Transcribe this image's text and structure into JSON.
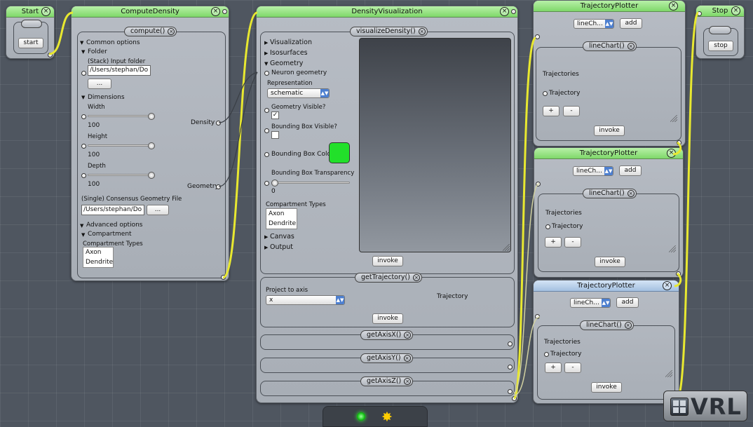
{
  "start_window": {
    "title": "Start",
    "button": "start"
  },
  "stop_window": {
    "title": "Stop",
    "button": "stop"
  },
  "compute_density": {
    "title": "ComputeDensity",
    "method": "compute()",
    "common_options": "Common options",
    "folder": "Folder",
    "input_folder_label": "(Stack) Input folder",
    "input_folder_value": "/Users/stephan/Do",
    "browse_button": "...",
    "dimensions": "Dimensions",
    "width_label": "Width",
    "width_value": "100",
    "height_label": "Height",
    "height_value": "100",
    "depth_label": "Depth",
    "depth_value": "100",
    "geometry_file_label": "(Single) Consensus Geometry File",
    "geometry_file_value": "/Users/stephan/Do",
    "browse_button2": "...",
    "advanced_options": "Advanced options",
    "compartment": "Compartment",
    "compartment_types_label": "Compartment Types",
    "compartment_types": [
      "Axon",
      "Dendrite"
    ],
    "output_density": "Density",
    "output_geometry": "Geometry"
  },
  "density_visualization": {
    "title": "DensityVisualization",
    "method1": "visualizeDensity()",
    "visualization": "Visualization",
    "isosurfaces": "Isosurfaces",
    "geometry": "Geometry",
    "neuron_geometry": "Neuron geometry",
    "representation_label": "Representation",
    "representation_value": "schematic",
    "geometry_visible_label": "Geometry Visible?",
    "geometry_visible_check": "✓",
    "bounding_box_visible_label": "Bounding Box Visible?",
    "bounding_box_color_label": "Bounding Box Color",
    "bounding_box_color": "#22e02a",
    "bounding_box_transparency_label": "Bounding Box Transparency",
    "bounding_box_transparency_value": "0",
    "compartment_types_label": "Compartment Types",
    "compartment_types": [
      "Axon",
      "Dendrite"
    ],
    "canvas": "Canvas",
    "output": "Output",
    "invoke1": "invoke",
    "method2": "getTrajectory()",
    "project_to_axis_label": "Project to axis",
    "project_to_axis_value": "x",
    "trajectory_out": "Trajectory",
    "invoke2": "invoke",
    "method3": "getAxisX()",
    "method4": "getAxisY()",
    "method5": "getAxisZ()"
  },
  "plotters": [
    {
      "title": "TrajectoryPlotter",
      "select": "lineCh...",
      "add": "add",
      "method": "lineChart()",
      "trajectories": "Trajectories",
      "trajectory": "Trajectory",
      "plus": "+",
      "minus": "-",
      "invoke": "invoke"
    },
    {
      "title": "TrajectoryPlotter",
      "select": "lineCh...",
      "add": "add",
      "method": "lineChart()",
      "trajectories": "Trajectories",
      "trajectory": "Trajectory",
      "plus": "+",
      "minus": "-",
      "invoke": "invoke"
    },
    {
      "title": "TrajectoryPlotter",
      "select": "lineCh...",
      "add": "add",
      "method": "lineChart()",
      "trajectories": "Trajectories",
      "trajectory": "Trajectory",
      "plus": "+",
      "minus": "-",
      "invoke": "invoke"
    }
  ],
  "close_symbol": "×",
  "tri_right": "▶",
  "tri_down": "▼",
  "select_arrow": "▲▼",
  "logo": {
    "text": "VRL"
  },
  "colors": {
    "title_active": "#7fd86a",
    "title_selected": "#a4c0e0",
    "wire": "#e8e830"
  }
}
